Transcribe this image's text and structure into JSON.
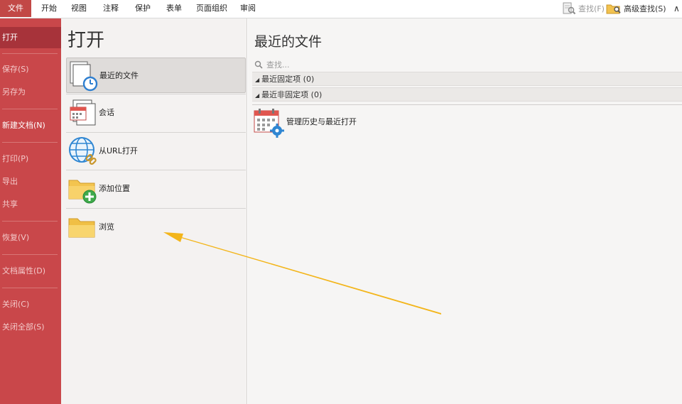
{
  "tabs": [
    "文件",
    "开始",
    "视图",
    "注释",
    "保护",
    "表单",
    "页面组织",
    "审阅"
  ],
  "toolbar": {
    "find_label": "查找(F)",
    "advanced_find_label": "高级查找(S)"
  },
  "nav": {
    "open": "打开",
    "save": "保存(S)",
    "save_as": "另存为",
    "new_document": "新建文档(N)",
    "print": "打印(P)",
    "export": "导出",
    "share": "共享",
    "revert": "恢复(V)",
    "properties": "文档属性(D)",
    "close": "关闭(C)",
    "close_all": "关闭全部(S)"
  },
  "open_panel": {
    "title": "打开",
    "options": [
      "最近的文件",
      "会话",
      "从URL打开",
      "添加位置",
      "浏览"
    ]
  },
  "recent": {
    "title": "最近的文件",
    "search_placeholder": "查找...",
    "pinned_group": "最近固定项 (0)",
    "unpinned_group": "最近非固定项 (0)",
    "history_label": "管理历史与最近打开"
  },
  "colors": {
    "accent": "#c9474a",
    "annotation_arrow": "#f3b51a"
  },
  "icons": {
    "recent_files": "recent-files-icon",
    "sessions": "sessions-icon",
    "url": "globe-link-icon",
    "add_location": "folder-add-icon",
    "browse": "folder-icon",
    "history": "calendar-gear-icon"
  }
}
